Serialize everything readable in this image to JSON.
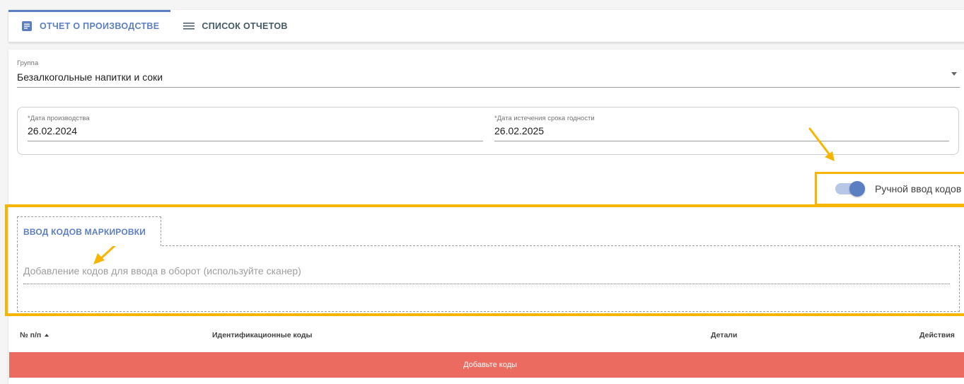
{
  "tabs": [
    {
      "label": "ОТЧЕТ О ПРОИЗВОДСТВЕ",
      "icon": "document-icon",
      "active": true
    },
    {
      "label": "СПИСОК ОТЧЕТОВ",
      "icon": "list-icon",
      "active": false
    }
  ],
  "group": {
    "label": "Группа",
    "value": "Безалкогольные напитки и соки"
  },
  "dates": {
    "production_label": "*Дата производства",
    "production_value": "26.02.2024",
    "expiry_label": "*Дата истечения срока годности",
    "expiry_value": "26.02.2025"
  },
  "manual_entry": {
    "label": "Ручной ввод кодов",
    "enabled": true
  },
  "codes": {
    "tab_label": "ВВОД КОДОВ МАРКИРОВКИ",
    "placeholder": "Добавление кодов для ввода в оборот (используйте сканер)"
  },
  "table": {
    "columns": [
      "№ п/п",
      "Идентификационные коды",
      "Детали",
      "Действия"
    ],
    "empty_message": "Добавьте коды"
  },
  "colors": {
    "accent": "#5c7fc2",
    "highlight": "#f7b500",
    "error": "#ec6b61"
  }
}
